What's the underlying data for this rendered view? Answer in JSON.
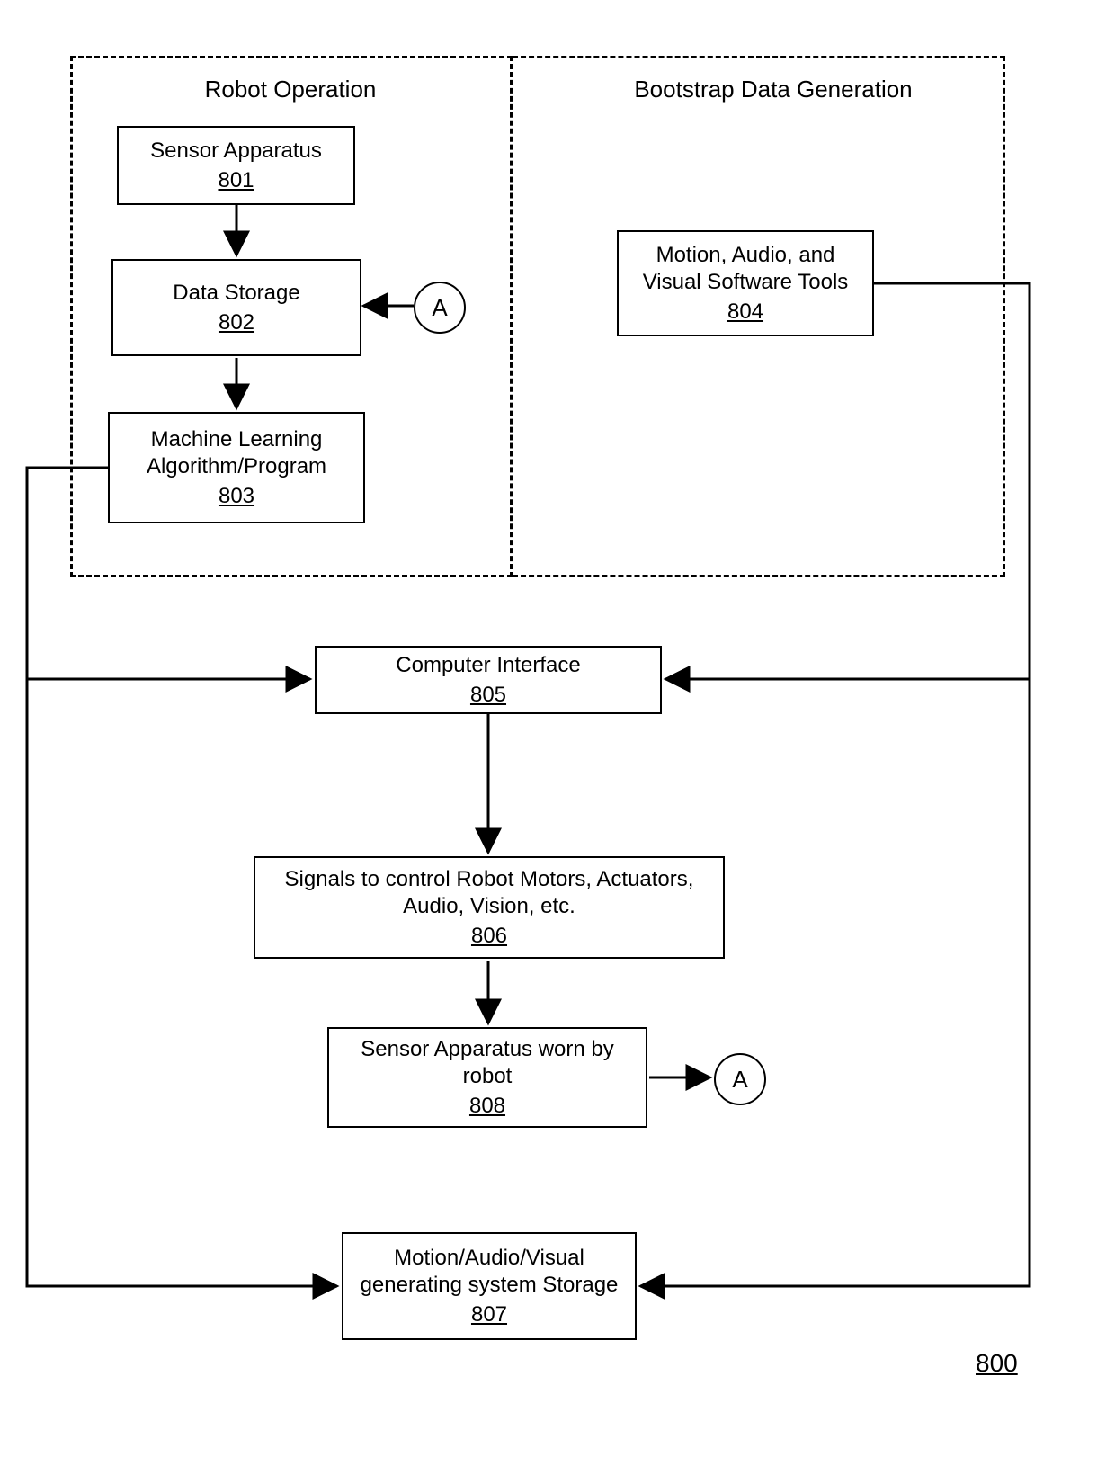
{
  "groups": {
    "robot_operation": {
      "title": "Robot Operation"
    },
    "bootstrap": {
      "title": "Bootstrap Data Generation"
    }
  },
  "boxes": {
    "b801": {
      "label": "Sensor Apparatus",
      "ref": "801"
    },
    "b802": {
      "label": "Data Storage",
      "ref": "802"
    },
    "b803": {
      "label": "Machine Learning Algorithm/Program",
      "ref": "803"
    },
    "b804": {
      "label": "Motion, Audio, and Visual Software Tools",
      "ref": "804"
    },
    "b805": {
      "label": "Computer Interface",
      "ref": "805"
    },
    "b806": {
      "label": "Signals to control Robot Motors, Actuators, Audio, Vision, etc.",
      "ref": "806"
    },
    "b807": {
      "label": "Motion/Audio/Visual generating system Storage",
      "ref": "807"
    },
    "b808": {
      "label": "Sensor Apparatus worn by robot",
      "ref": "808"
    }
  },
  "connectors": {
    "A1": "A",
    "A2": "A"
  },
  "figure_ref": "800"
}
